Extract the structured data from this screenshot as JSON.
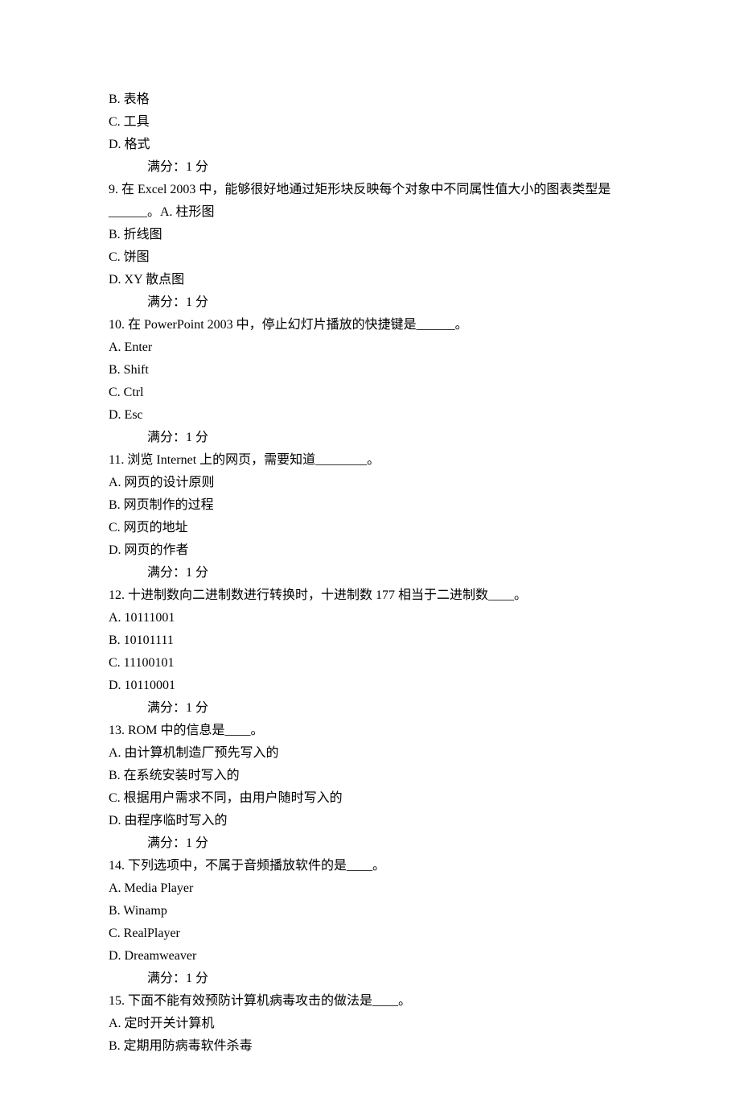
{
  "prefix_options": [
    "B.  表格",
    "C.  工具",
    "D.  格式"
  ],
  "prefix_score": "满分：1   分",
  "q9": {
    "stem": "9.    在 Excel 2003 中，能够很好地通过矩形块反映每个对象中不同属性值大小的图表类型是______。A.  柱形图",
    "opts": [
      "B.  折线图",
      "C.  饼图"
    ],
    "blank": "",
    "opt_d": "D. XY 散点图",
    "score": "满分：1   分"
  },
  "q10": {
    "stem": "10.    在 PowerPoint 2003 中，停止幻灯片播放的快捷键是______。",
    "opts": [
      "A. Enter",
      "B. Shift",
      "C. Ctrl",
      "D. Esc"
    ],
    "score": "满分：1   分"
  },
  "q11": {
    "stem": "11.    浏览 Internet 上的网页，需要知道________。",
    "opts": [
      "A.  网页的设计原则",
      "B.  网页制作的过程",
      "C.  网页的地址",
      "D.  网页的作者"
    ],
    "score": "满分：1   分"
  },
  "q12": {
    "stem": "12.    十进制数向二进制数进行转换时，十进制数 177 相当于二进制数____。",
    "opts": [
      "A. 10111001",
      "B. 10101111",
      "C. 11100101",
      "D. 10110001"
    ],
    "score": "满分：1   分"
  },
  "q13": {
    "stem": "13.    ROM 中的信息是____。",
    "opts": [
      "A.  由计算机制造厂预先写入的",
      "B.  在系统安装时写入的",
      "C.  根据用户需求不同，由用户随时写入的",
      "D.  由程序临时写入的"
    ],
    "score": "满分：1   分"
  },
  "q14": {
    "stem": "14.    下列选项中，不属于音频播放软件的是____。",
    "opts": [
      "A. Media Player",
      "B. Winamp",
      "C. RealPlayer",
      "D. Dreamweaver"
    ],
    "score": "满分：1   分"
  },
  "q15": {
    "stem": "15.    下面不能有效预防计算机病毒攻击的做法是____。",
    "opts": [
      "A.  定时开关计算机",
      "B.  定期用防病毒软件杀毒"
    ]
  }
}
